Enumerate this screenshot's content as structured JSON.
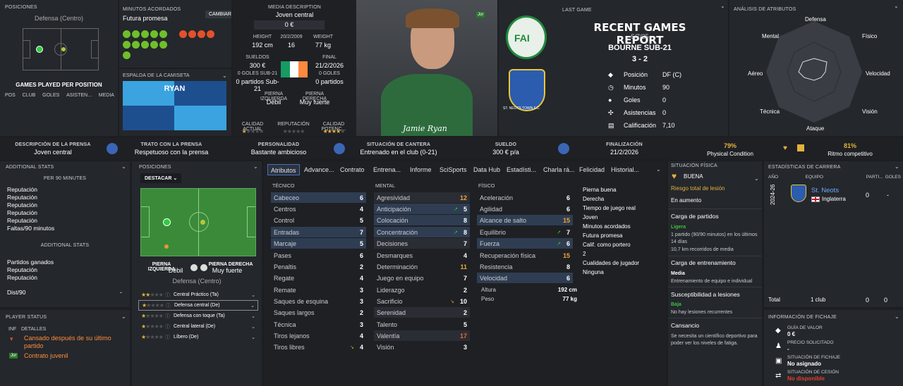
{
  "positions": {
    "title": "POSICIONES",
    "subtitle": "Defensa (Centro)",
    "games_title": "GAMES PLAYED PER POSITION",
    "cols": [
      "POS",
      "CLUB",
      "GOLES",
      "ASISTEN...",
      "MEDIA"
    ]
  },
  "agreed": {
    "title": "MINUTOS ACORDADOS",
    "value": "Futura promesa",
    "button": "CAMBIAR"
  },
  "shirt": {
    "title": "ESPALDA DE LA CAMISETA",
    "name": "RYAN"
  },
  "media": {
    "desc_title": "MEDIA DESCRIPTION",
    "desc": "Joven central",
    "value": "0 €",
    "height_l": "HEIGHT",
    "height": "192 cm",
    "dob": "20/2/2009",
    "age": "16",
    "weight_l": "WEIGHT",
    "weight": "77 kg",
    "wages_l": "SUELDOS",
    "wages": "300 €",
    "final_l": "FINAL",
    "final": "21/2/2026",
    "goals_sub": "0 GOLES SUB-21",
    "apps_sub": "0 partidos Sub-21",
    "goals": "0 GOLES",
    "apps": "0 partidos",
    "left_foot_l": "PIERNA IZQUIERDA",
    "left_foot": "Débil",
    "right_foot_l": "PIERNA DERECHA",
    "right_foot": "Muy fuerte",
    "ca_l": "CALIDAD ACTUAL",
    "rep_l": "REPUTACIÓN",
    "pa_l": "CALIDAD POTENC..."
  },
  "photo": {
    "signature": "Jamie Ryan",
    "badge": "Jor"
  },
  "last_game": {
    "title": "LAST GAME",
    "report": "RECENT GAMES REPORT",
    "date": "5/7/25",
    "opponent": "BOURNE SUB-21",
    "score": "3 - 2",
    "stats": [
      {
        "l": "Posición",
        "v": "DF (C)"
      },
      {
        "l": "Minutos",
        "v": "90"
      },
      {
        "l": "Goles",
        "v": "0"
      },
      {
        "l": "Asistencias",
        "v": "0"
      },
      {
        "l": "Calificación",
        "v": "7,10"
      }
    ],
    "club_text": "ST. NEOTS TOWN F.C."
  },
  "radar": {
    "title": "ANÁLISIS DE ATRIBUTOS",
    "labels": [
      "Defensa",
      "Físico",
      "Velocidad",
      "Visión",
      "Ataque",
      "Técnica",
      "Aéreo",
      "Mental"
    ]
  },
  "infobar": [
    {
      "t": "DESCRIPCIÓN DE LA PRENSA",
      "v": "Joven central"
    },
    {
      "t": "TRATO CON LA PRENSA",
      "v": "Respetuoso con la prensa"
    },
    {
      "t": "PERSONALIDAD",
      "v": "Bastante ambicioso"
    },
    {
      "t": "SITUACIÓN DE CANTERA",
      "v": "Entrenado en el club (0-21)"
    },
    {
      "t": "SUELDO",
      "v": "300 € p/a"
    },
    {
      "t": "FINALIZACIÓN",
      "v": "21/2/2026"
    }
  ],
  "condition": {
    "pct": "79%",
    "label": "Physical Condition",
    "rpct": "81%",
    "rlabel": "Ritmo competitivo"
  },
  "additional": {
    "title": "ADDITIONAL STATS",
    "per90": "PER 90 MINUTES",
    "items": [
      "Reputación",
      "Reputación",
      "Reputación",
      "Reputación",
      "Reputación",
      "Faltas/90 minutos"
    ],
    "sub": "ADDITIONAL STATS",
    "items2": [
      "Partidos ganados",
      "Reputación",
      "Reputación"
    ],
    "dist": "Dist/90",
    "dist_v": "-"
  },
  "player_status": {
    "title": "PLAYER STATUS",
    "cols": [
      "INF",
      "DETALLES"
    ],
    "items": [
      "Cansado después de su último partido",
      "Contrato juvenil"
    ],
    "badge": "Jor"
  },
  "pos_panel": {
    "title": "POSICIONES",
    "dropdown": "DESTACAR",
    "lf_l": "PIERNA IZQUIERDA",
    "lf": "Débil",
    "rf_l": "PIERNA DERECHA",
    "rf": "Muy fuerte",
    "pos": "Defensa (Centro)",
    "roles": [
      "Central Práctico (Ta)",
      "Defensa central (De)",
      "Defensa con toque (Ta)",
      "Central lateral (De)",
      "Líbero (De)"
    ]
  },
  "tabs": [
    "Atributos",
    "Advance...",
    "Contrato",
    "Entrena...",
    "Informe",
    "SciSports",
    "Data Hub",
    "Estadísti...",
    "Charla rá...",
    "Felicidad",
    "Historial..."
  ],
  "attrs": {
    "tec_title": "TÉCNICO",
    "tec": [
      [
        "Cabeceo",
        "6"
      ],
      [
        "Centros",
        "4"
      ],
      [
        "Control",
        "5"
      ],
      [
        "Entradas",
        "7"
      ],
      [
        "Marcaje",
        "5"
      ],
      [
        "Pases",
        "6"
      ],
      [
        "Penaltis",
        "2"
      ],
      [
        "Regate",
        "4"
      ],
      [
        "Remate",
        "3"
      ],
      [
        "Saques de esquina",
        "3"
      ],
      [
        "Saques largos",
        "2"
      ],
      [
        "Técnica",
        "3"
      ],
      [
        "Tiros lejanos",
        "4"
      ],
      [
        "Tiros libres",
        "4"
      ]
    ],
    "men_title": "MENTAL",
    "men": [
      [
        "Agresividad",
        "12"
      ],
      [
        "Anticipación",
        "5"
      ],
      [
        "Colocación",
        "8"
      ],
      [
        "Concentración",
        "8"
      ],
      [
        "Decisiones",
        "7"
      ],
      [
        "Desmarques",
        "4"
      ],
      [
        "Determinación",
        "11"
      ],
      [
        "Juego en equipo",
        "7"
      ],
      [
        "Liderazgo",
        "2"
      ],
      [
        "Sacrificio",
        "10"
      ],
      [
        "Serenidad",
        "2"
      ],
      [
        "Talento",
        "5"
      ],
      [
        "Valentía",
        "17"
      ],
      [
        "Visión",
        "3"
      ]
    ],
    "fis_title": "FÍSICO",
    "fis": [
      [
        "Aceleración",
        "6"
      ],
      [
        "Agilidad",
        "6"
      ],
      [
        "Alcance de salto",
        "15"
      ],
      [
        "Equilibrio",
        "7"
      ],
      [
        "Fuerza",
        "6"
      ],
      [
        "Recuperación física",
        "15"
      ],
      [
        "Resistencia",
        "8"
      ],
      [
        "Velocidad",
        "6"
      ]
    ],
    "height_l": "Altura",
    "height": "192 cm",
    "weight_l": "Peso",
    "weight": "77 kg",
    "info": [
      "Pierna buena",
      "Derecha",
      "Tiempo de juego real",
      "Joven",
      "Minutos acordados",
      "Futura promesa",
      "Calif. como portero",
      "2",
      "Cualidades de jugador",
      "Ninguna"
    ]
  },
  "physical": {
    "title": "SITUACIÓN FÍSICA",
    "state": "BUENA",
    "risk": "Riesgo total de lesión",
    "trend": "En aumento",
    "load_t": "Carga de partidos",
    "load_v": "Ligera",
    "load_d": "1 partido (90/90 minutos) en los últimos 14 días",
    "dist": "10,7 km recorridos de media",
    "train_t": "Carga de entrenamiento",
    "train_v": "Media",
    "train_d": "Entrenamiento de equipo e individual",
    "inj_t": "Susceptibilidad a lesiones",
    "inj_v": "Baja",
    "inj_d": "No hay lesiones recurrentes",
    "tired_t": "Cansancio",
    "tired_d": "Se necesita un científico deportivo para poder ver los niveles de fatiga."
  },
  "career": {
    "title": "ESTADÍSTICAS DE CARRERA",
    "cols": [
      "AÑO",
      "EQUIPO",
      "PARTI...",
      "GOLES"
    ],
    "year": "2024-26",
    "team": "St. Neots",
    "country": "Inglaterra",
    "apps": "0",
    "goals": "-",
    "total": "Total",
    "total_clubs": "1 club",
    "total_apps": "0",
    "total_goals": "0"
  },
  "transfer": {
    "title": "INFORMACIÓN DE FICHAJE",
    "items": [
      {
        "t": "GUÍA DE VALOR",
        "v": "0 €"
      },
      {
        "t": "PRECIO SOLICITADO",
        "v": "-"
      },
      {
        "t": "SITUACIÓN DE FICHAJE",
        "v": "No asignado"
      },
      {
        "t": "SITUACIÓN DE CESIÓN",
        "v": "No disponible"
      }
    ]
  }
}
